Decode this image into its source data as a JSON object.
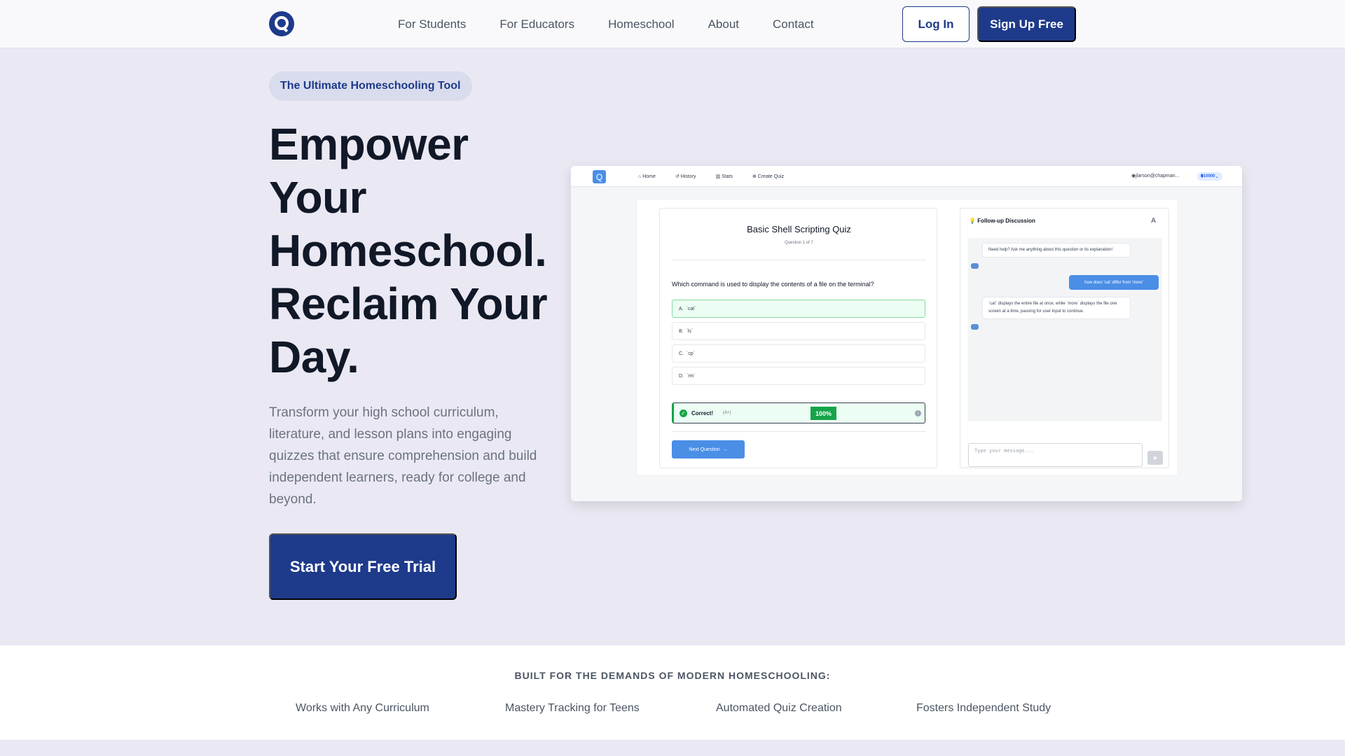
{
  "nav": {
    "links": [
      "For Students",
      "For Educators",
      "Homeschool",
      "About",
      "Contact"
    ],
    "login_label": "Log In",
    "signup_label": "Sign Up Free"
  },
  "hero": {
    "pill": "The Ultimate Homeschooling Tool",
    "headline": "Empower Your Homeschool. Reclaim Your Day.",
    "subtext": "Transform your high school curriculum, literature, and lesson plans into engaging quizzes that ensure comprehension and build independent learners, ready for college and beyond.",
    "cta_label": "Start Your Free Trial"
  },
  "mock": {
    "logo_letter": "Q",
    "nav_items": [
      "Home",
      "History",
      "Stats",
      "Create Quiz"
    ],
    "user": "jlarson@chapman...",
    "coins": "10000",
    "quiz": {
      "title": "Basic Shell Scripting Quiz",
      "progress": "Question 1 of 7",
      "question": "Which command is used to display the contents of a file on the terminal?",
      "options": [
        {
          "letter": "A.",
          "text": "`cat`"
        },
        {
          "letter": "B.",
          "text": "`ls`"
        },
        {
          "letter": "C.",
          "text": "`cp`"
        },
        {
          "letter": "D.",
          "text": "`rm`"
        }
      ],
      "result_label": "Correct!",
      "result_grade": "(A+)",
      "result_percent": "100%",
      "next_label": "Next Question"
    },
    "chat": {
      "title": "Follow-up Discussion",
      "font_toggle": "A",
      "bot_msg_1": "Need help? Ask me anything about this question or its explanation!",
      "user_msg": "how does 'cat' differ from 'more'",
      "bot_msg_2": "`cat` displays the entire file at once, while `more` displays the file one screen at a time, pausing for user input to continue.",
      "input_placeholder": "Type your message..."
    }
  },
  "band": {
    "title": "BUILT FOR THE DEMANDS OF MODERN HOMESCHOOLING:",
    "features": [
      "Works with Any Curriculum",
      "Mastery Tracking for Teens",
      "Automated Quiz Creation",
      "Fosters Independent Study"
    ]
  },
  "colors": {
    "brand": "#1e3a8a",
    "accent": "#4a8ee6",
    "success": "#16a34a",
    "hero_bg": "#eae9f3"
  }
}
